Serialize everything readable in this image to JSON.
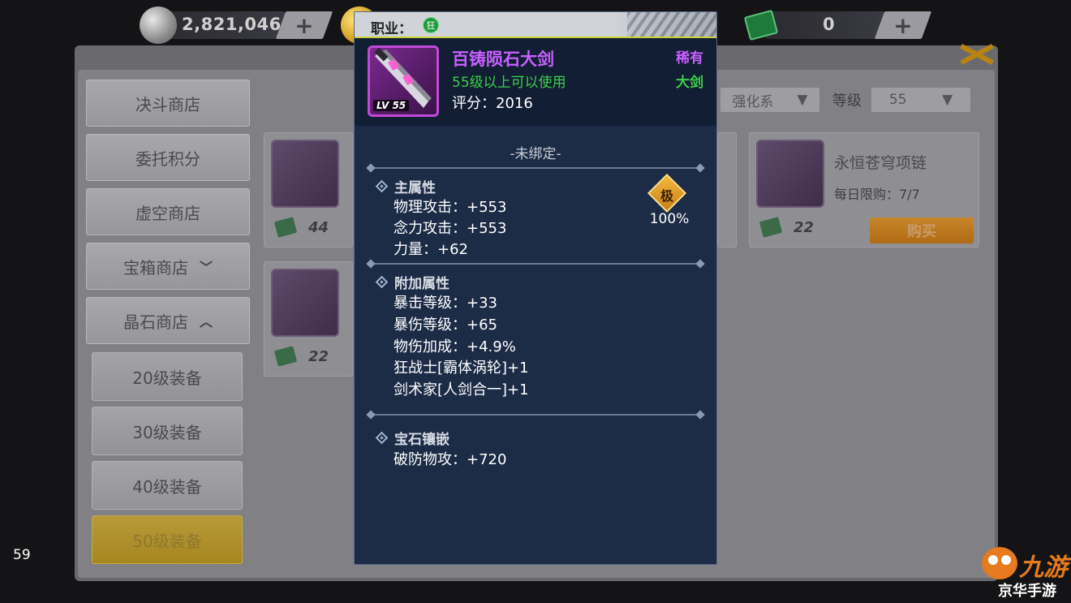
{
  "currency": {
    "silver_amount": "2,821,046",
    "ticket_amount": "0",
    "add_label": "+"
  },
  "sidebar": {
    "items": [
      {
        "label": "决斗商店",
        "chevron": ""
      },
      {
        "label": "委托积分",
        "chevron": ""
      },
      {
        "label": "虚空商店",
        "chevron": ""
      },
      {
        "label": "宝箱商店",
        "chevron": "﹀"
      },
      {
        "label": "晶石商店",
        "chevron": "︿"
      }
    ],
    "sub_items": [
      {
        "label": "20级装备",
        "active": false
      },
      {
        "label": "30级装备",
        "active": false
      },
      {
        "label": "40级装备",
        "active": false
      },
      {
        "label": "50级装备",
        "active": true
      }
    ]
  },
  "filters": {
    "type_value": "强化系",
    "level_label": "等级",
    "level_value": "55"
  },
  "shop_items": [
    {
      "name": "",
      "price": "44"
    },
    {
      "name": "",
      "price": "22"
    },
    {
      "name": "永恒苍穹项链",
      "limit": "每日限购：7/7",
      "price": "22",
      "buy_label": "购买"
    },
    {
      "name": "",
      "price": "22"
    }
  ],
  "fps": "59",
  "tooltip": {
    "job_label": "职业：",
    "job_icon_text": "狂",
    "item_name": "百铸陨石大剑",
    "requirement": "55级以上可以使用",
    "score": "评分：2016",
    "rarity": "稀有",
    "weapon_type": "大剑",
    "level_badge": "LV 55",
    "bind_status": "-未绑定-",
    "main_attr_title": "主属性",
    "main_attrs": [
      "物理攻击：+553",
      "念力攻击：+553",
      "力量：+62"
    ],
    "grade": {
      "symbol": "极",
      "percent": "100%"
    },
    "extra_attr_title": "附加属性",
    "extra_attrs": [
      "暴击等级：+33",
      "暴伤等级：+65",
      "物伤加成：+4.9%",
      "狂战士[霸体涡轮]+1",
      "剑术家[人剑合一]+1"
    ],
    "gem_title": "宝石镶嵌",
    "gem_attrs": [
      "破防物攻：+720"
    ]
  },
  "watermark": {
    "logo_text": "九游",
    "sub_text": "京华手游"
  },
  "colors": {
    "rarity_purple": "#c860ff",
    "req_green": "#3ccf4c",
    "tooltip_bg": "#1c2c47",
    "active_gold": "#b89a3a"
  }
}
